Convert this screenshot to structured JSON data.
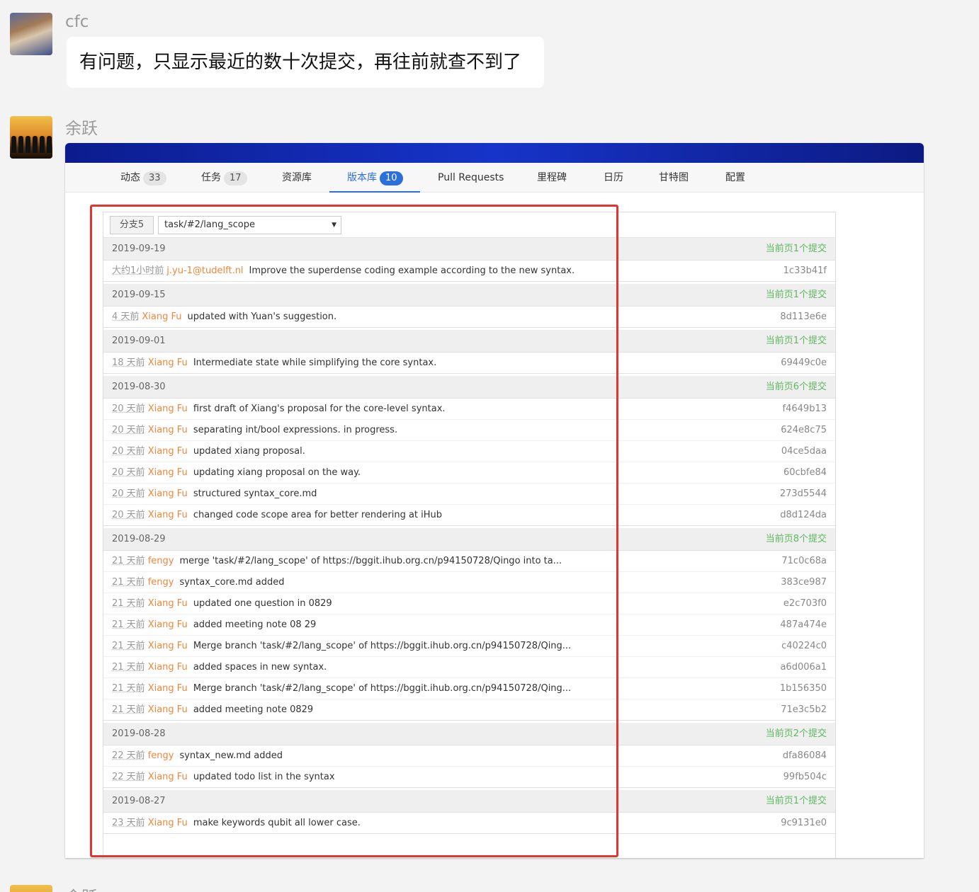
{
  "messages": [
    {
      "sender": "cfc",
      "text": "有问题，只显示最近的数十次提交，再往前就查不到了"
    },
    {
      "sender": "余跃"
    },
    {
      "sender": "余跃"
    }
  ],
  "screenshot": {
    "tabs": [
      {
        "label": "动态",
        "count": "33"
      },
      {
        "label": "任务",
        "count": "17"
      },
      {
        "label": "资源库"
      },
      {
        "label": "版本库",
        "count": "10",
        "active": true
      },
      {
        "label": "Pull Requests"
      },
      {
        "label": "里程碑"
      },
      {
        "label": "日历"
      },
      {
        "label": "甘特图"
      },
      {
        "label": "配置"
      }
    ],
    "branch_button": "分支5",
    "branch_select": "task/#2/lang_scope",
    "groups": [
      {
        "date": "2019-09-19",
        "count_label": "当前页1个提交",
        "commits": [
          {
            "time": "大约1小时前",
            "author": "j.yu-1@tudelft.nl",
            "message": "Improve the superdense coding example according to the new syntax.",
            "hash": "1c33b41f"
          }
        ]
      },
      {
        "date": "2019-09-15",
        "count_label": "当前页1个提交",
        "commits": [
          {
            "time": "4 天前",
            "author": "Xiang Fu",
            "message": "updated with Yuan's suggestion.",
            "hash": "8d113e6e"
          }
        ]
      },
      {
        "date": "2019-09-01",
        "count_label": "当前页1个提交",
        "commits": [
          {
            "time": "18 天前",
            "author": "Xiang Fu",
            "message": "Intermediate state while simplifying the core syntax.",
            "hash": "69449c0e"
          }
        ]
      },
      {
        "date": "2019-08-30",
        "count_label": "当前页6个提交",
        "commits": [
          {
            "time": "20 天前",
            "author": "Xiang Fu",
            "message": "first draft of Xiang's proposal for the core-level syntax.",
            "hash": "f4649b13"
          },
          {
            "time": "20 天前",
            "author": "Xiang Fu",
            "message": "separating int/bool expressions. in progress.",
            "hash": "624e8c75"
          },
          {
            "time": "20 天前",
            "author": "Xiang Fu",
            "message": "updated xiang proposal.",
            "hash": "04ce5daa"
          },
          {
            "time": "20 天前",
            "author": "Xiang Fu",
            "message": "updating xiang proposal on the way.",
            "hash": "60cbfe84"
          },
          {
            "time": "20 天前",
            "author": "Xiang Fu",
            "message": "structured syntax_core.md",
            "hash": "273d5544"
          },
          {
            "time": "20 天前",
            "author": "Xiang Fu",
            "message": "changed code scope area for better rendering at iHub",
            "hash": "d8d124da"
          }
        ]
      },
      {
        "date": "2019-08-29",
        "count_label": "当前页8个提交",
        "commits": [
          {
            "time": "21 天前",
            "author": "fengy",
            "message": "merge 'task/#2/lang_scope' of https://bggit.ihub.org.cn/p94150728/Qingo into ta...",
            "hash": "71c0c68a"
          },
          {
            "time": "21 天前",
            "author": "fengy",
            "message": "syntax_core.md added",
            "hash": "383ce987"
          },
          {
            "time": "21 天前",
            "author": "Xiang Fu",
            "message": "updated one question in 0829",
            "hash": "e2c703f0"
          },
          {
            "time": "21 天前",
            "author": "Xiang Fu",
            "message": "added meeting note 08 29",
            "hash": "487a474e"
          },
          {
            "time": "21 天前",
            "author": "Xiang Fu",
            "message": "Merge branch 'task/#2/lang_scope' of https://bggit.ihub.org.cn/p94150728/Qing...",
            "hash": "c40224c0"
          },
          {
            "time": "21 天前",
            "author": "Xiang Fu",
            "message": "added spaces in new syntax.",
            "hash": "a6d006a1"
          },
          {
            "time": "21 天前",
            "author": "Xiang Fu",
            "message": "Merge branch 'task/#2/lang_scope' of https://bggit.ihub.org.cn/p94150728/Qing...",
            "hash": "1b156350"
          },
          {
            "time": "21 天前",
            "author": "Xiang Fu",
            "message": "added meeting note 0829",
            "hash": "71e3c5b2"
          }
        ]
      },
      {
        "date": "2019-08-28",
        "count_label": "当前页2个提交",
        "commits": [
          {
            "time": "22 天前",
            "author": "fengy",
            "message": "syntax_new.md added",
            "hash": "dfa86084"
          },
          {
            "time": "22 天前",
            "author": "Xiang Fu",
            "message": "updated todo list in the syntax",
            "hash": "99fb504c"
          }
        ]
      },
      {
        "date": "2019-08-27",
        "count_label": "当前页1个提交",
        "commits": [
          {
            "time": "23 天前",
            "author": "Xiang Fu",
            "message": "make keywords qubit all lower case.",
            "hash": "9c9131e0"
          }
        ]
      }
    ],
    "highlight_color": "#e3342f",
    "accent_color": "#2a6fdb"
  }
}
